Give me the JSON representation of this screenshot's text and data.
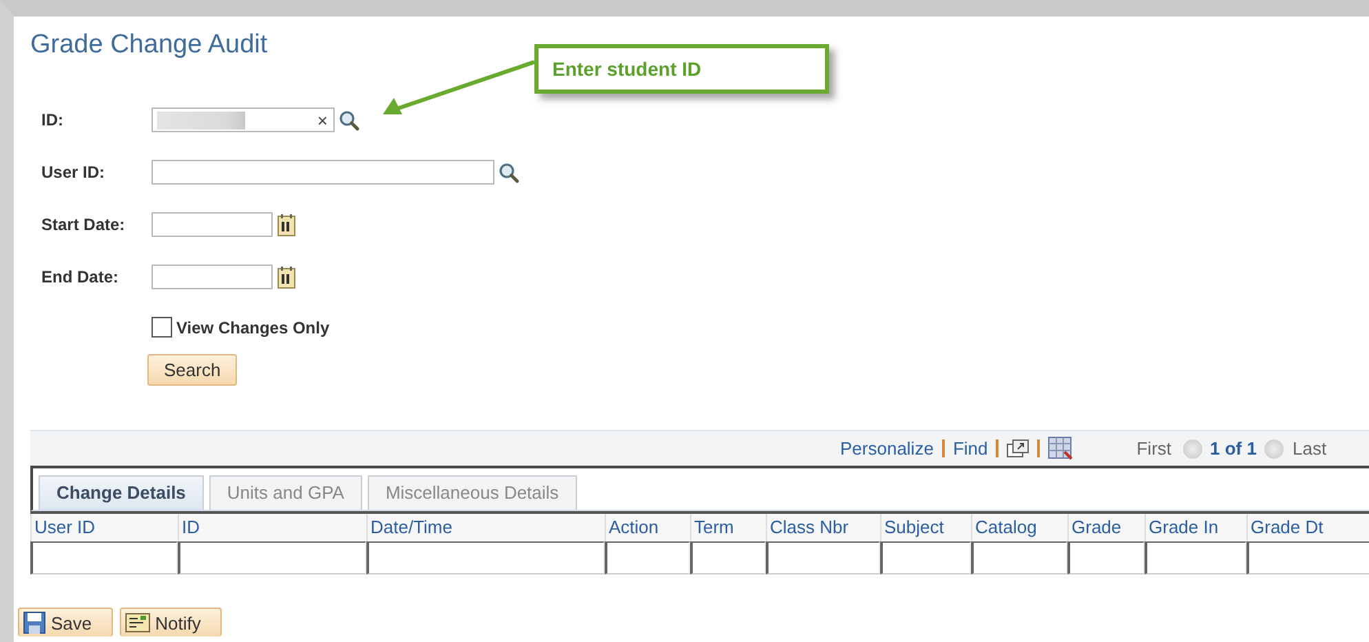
{
  "page": {
    "title": "Grade Change Audit"
  },
  "callout": {
    "text": "Enter student ID"
  },
  "fields": [
    {
      "label": "ID:",
      "kind": "lookup",
      "clear_icon": "×",
      "value_hidden": true
    },
    {
      "label": "User ID:",
      "kind": "lookup-wide"
    },
    {
      "label": "Start Date:",
      "kind": "date"
    },
    {
      "label": "End Date:",
      "kind": "date"
    }
  ],
  "checkbox": {
    "label": "View Changes Only",
    "checked": false
  },
  "search_button": "Search",
  "grid_toolbar": {
    "links": [
      "Personalize",
      "Find"
    ],
    "first": "First",
    "page": "1 of 1",
    "last": "Last"
  },
  "tabs": [
    {
      "label": "Change Details",
      "selected": true
    },
    {
      "label": "Units and GPA",
      "selected": false
    },
    {
      "label": "Miscellaneous Details",
      "selected": false
    }
  ],
  "table": {
    "columns": [
      "User ID",
      "ID",
      "Date/Time",
      "Action",
      "Term",
      "Class Nbr",
      "Subject",
      "Catalog",
      "Grade",
      "Grade In",
      "Grade Dt"
    ]
  },
  "buttons": [
    {
      "label": "Save",
      "kind": "save"
    },
    {
      "label": "Notify",
      "kind": "notify"
    }
  ]
}
